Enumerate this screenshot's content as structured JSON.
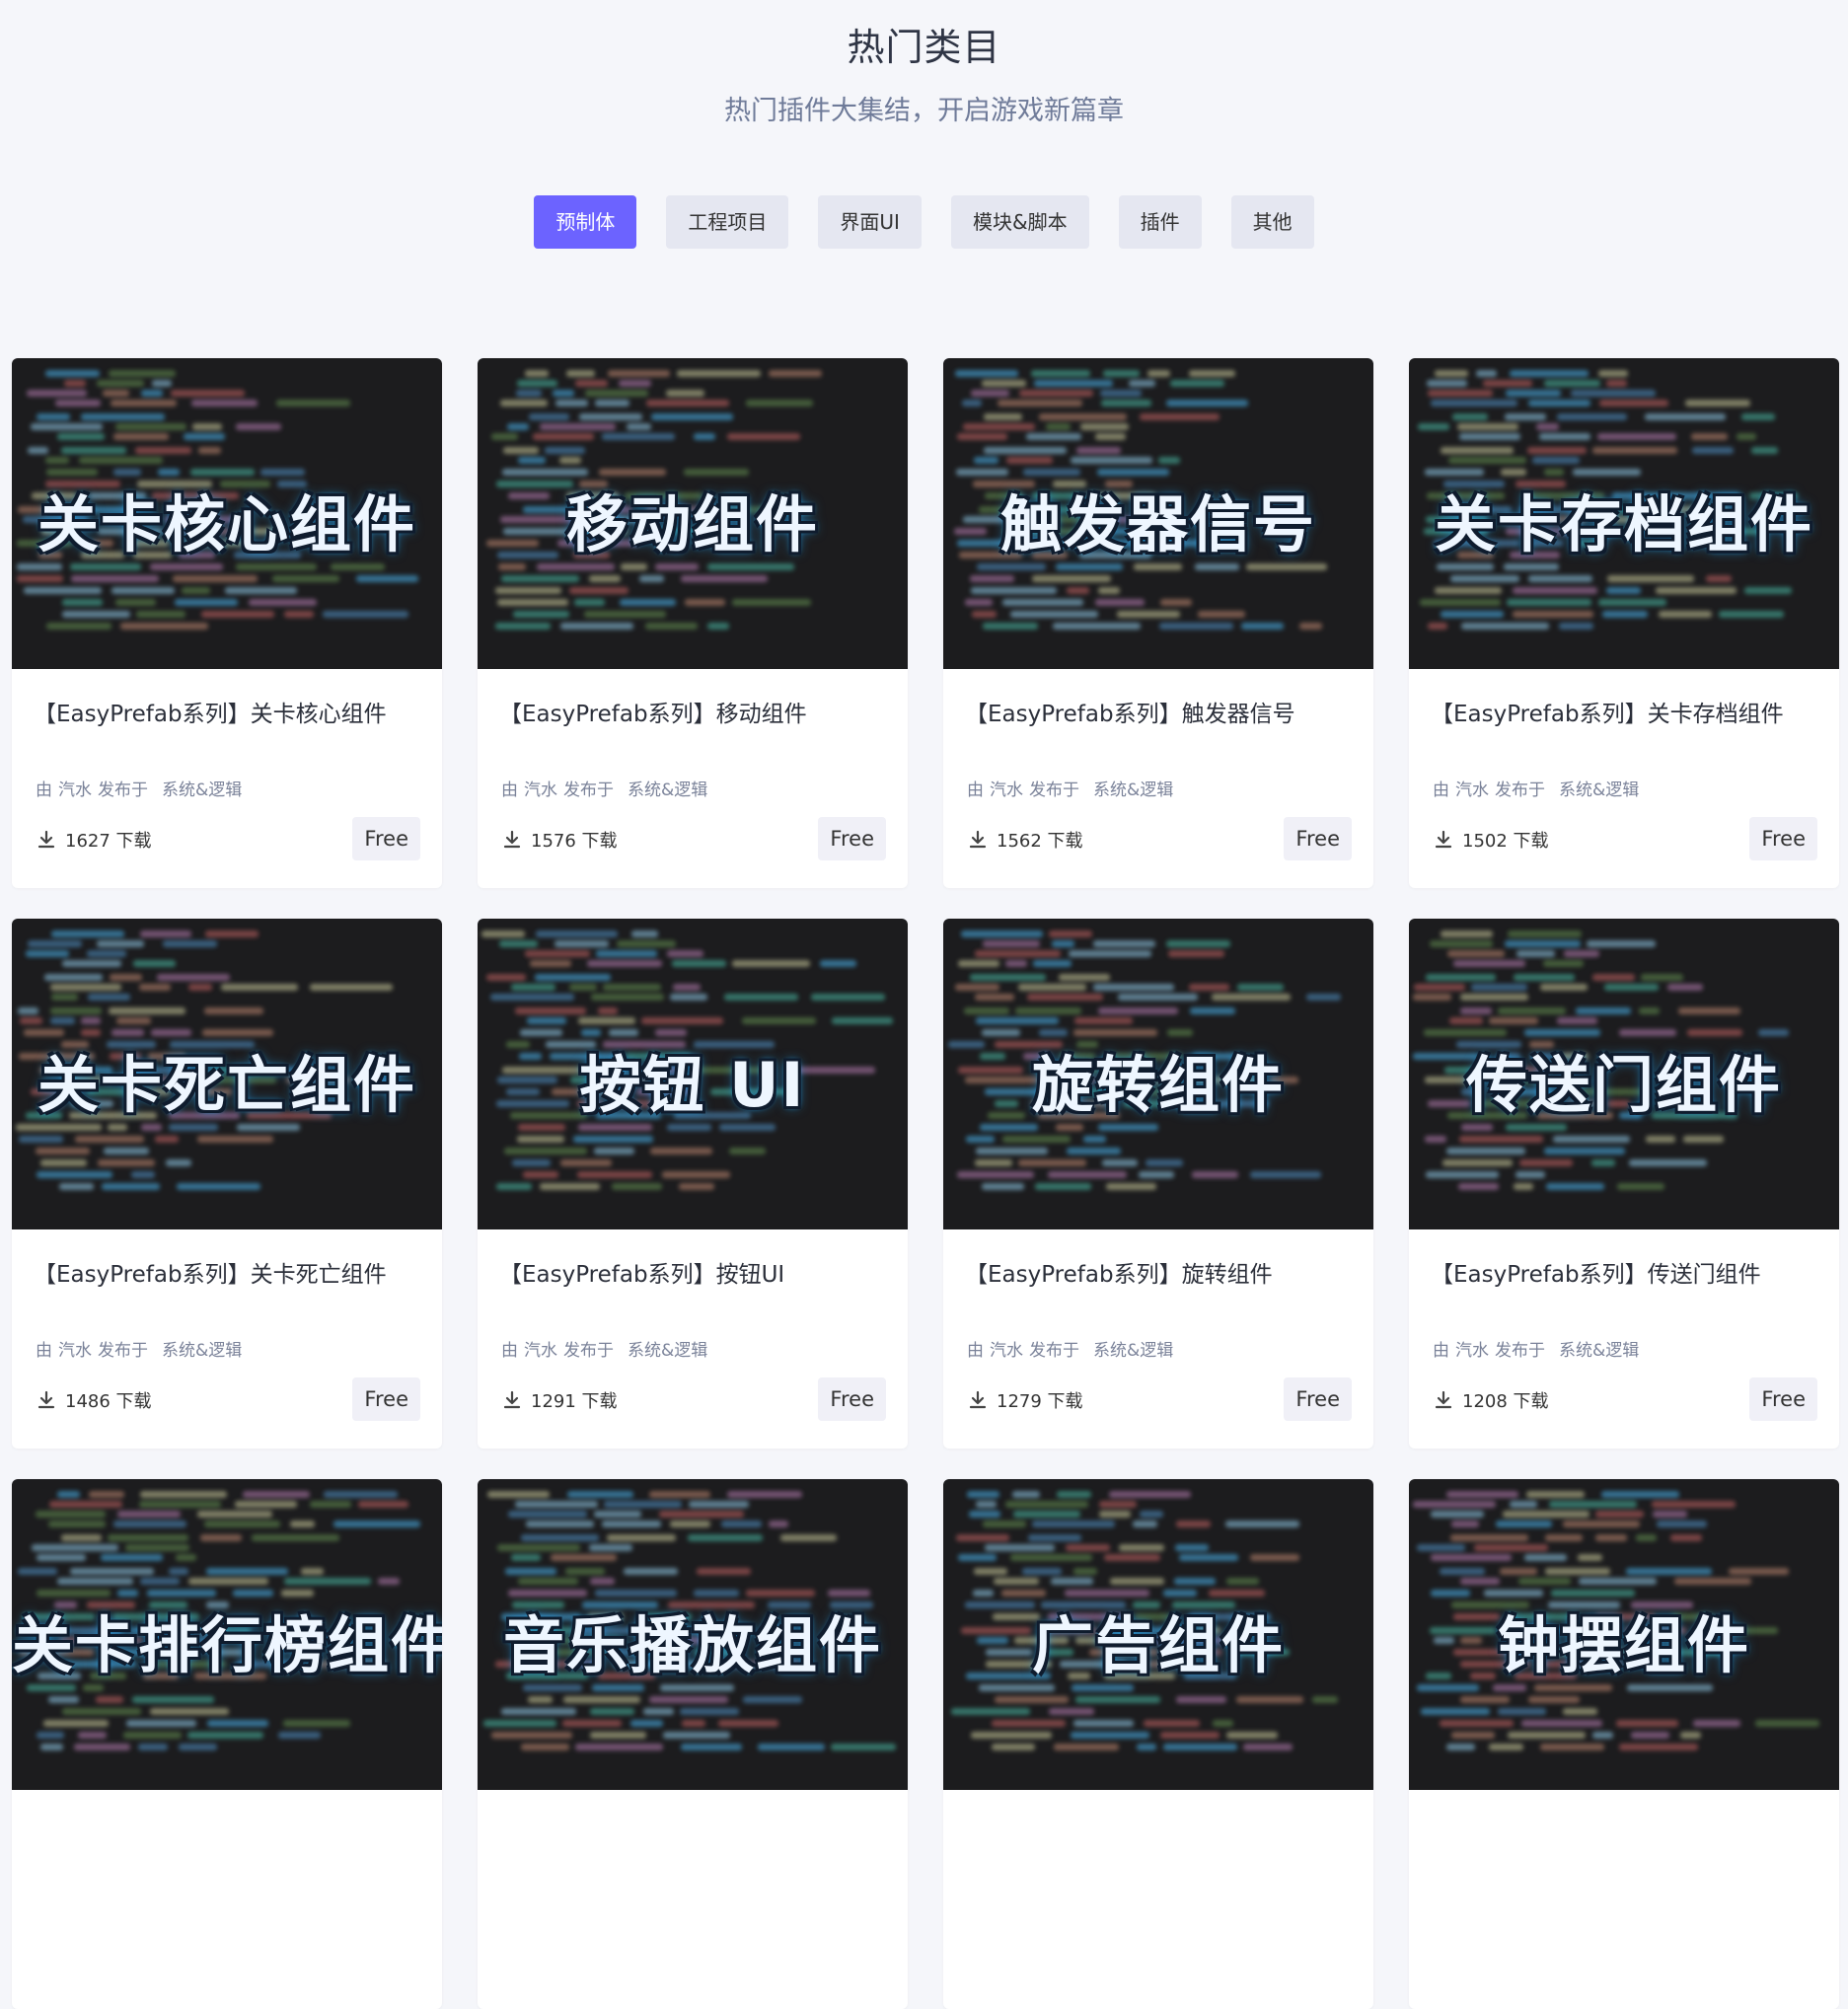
{
  "header": {
    "title": "热门类目",
    "subtitle": "热门插件大集结，开启游戏新篇章"
  },
  "tabs": [
    {
      "label": "预制体",
      "active": true
    },
    {
      "label": "工程项目",
      "active": false
    },
    {
      "label": "界面UI",
      "active": false
    },
    {
      "label": "模块&脚本",
      "active": false
    },
    {
      "label": "插件",
      "active": false
    },
    {
      "label": "其他",
      "active": false
    }
  ],
  "colors": {
    "accent": "#6c63ff",
    "tab_bg": "#e5e7f1",
    "page_bg": "#f5f6fa",
    "thumb_bg": "#1c1c1e"
  },
  "cards": [
    {
      "thumb_text": "关卡核心组件",
      "title": "【EasyPrefab系列】关卡核心组件",
      "by": "由",
      "author": "汽水",
      "published": "发布于",
      "category": "系统&逻辑",
      "downloads": "1627 下载",
      "price": "Free"
    },
    {
      "thumb_text": "移动组件",
      "title": "【EasyPrefab系列】移动组件",
      "by": "由",
      "author": "汽水",
      "published": "发布于",
      "category": "系统&逻辑",
      "downloads": "1576 下载",
      "price": "Free"
    },
    {
      "thumb_text": "触发器信号",
      "title": "【EasyPrefab系列】触发器信号",
      "by": "由",
      "author": "汽水",
      "published": "发布于",
      "category": "系统&逻辑",
      "downloads": "1562 下载",
      "price": "Free"
    },
    {
      "thumb_text": "关卡存档组件",
      "title": "【EasyPrefab系列】关卡存档组件",
      "by": "由",
      "author": "汽水",
      "published": "发布于",
      "category": "系统&逻辑",
      "downloads": "1502 下载",
      "price": "Free"
    },
    {
      "thumb_text": "关卡死亡组件",
      "title": "【EasyPrefab系列】关卡死亡组件",
      "by": "由",
      "author": "汽水",
      "published": "发布于",
      "category": "系统&逻辑",
      "downloads": "1486 下载",
      "price": "Free"
    },
    {
      "thumb_text": "按钮 UI",
      "title": "【EasyPrefab系列】按钮UI",
      "by": "由",
      "author": "汽水",
      "published": "发布于",
      "category": "系统&逻辑",
      "downloads": "1291 下载",
      "price": "Free"
    },
    {
      "thumb_text": "旋转组件",
      "title": "【EasyPrefab系列】旋转组件",
      "by": "由",
      "author": "汽水",
      "published": "发布于",
      "category": "系统&逻辑",
      "downloads": "1279 下载",
      "price": "Free"
    },
    {
      "thumb_text": "传送门组件",
      "title": "【EasyPrefab系列】传送门组件",
      "by": "由",
      "author": "汽水",
      "published": "发布于",
      "category": "系统&逻辑",
      "downloads": "1208 下载",
      "price": "Free"
    },
    {
      "thumb_text": "关卡排行榜组件",
      "title": "",
      "by": "",
      "author": "",
      "published": "",
      "category": "",
      "downloads": "",
      "price": ""
    },
    {
      "thumb_text": "音乐播放组件",
      "title": "",
      "by": "",
      "author": "",
      "published": "",
      "category": "",
      "downloads": "",
      "price": ""
    },
    {
      "thumb_text": "广告组件",
      "title": "",
      "by": "",
      "author": "",
      "published": "",
      "category": "",
      "downloads": "",
      "price": ""
    },
    {
      "thumb_text": "钟摆组件",
      "title": "",
      "by": "",
      "author": "",
      "published": "",
      "category": "",
      "downloads": "",
      "price": ""
    }
  ]
}
